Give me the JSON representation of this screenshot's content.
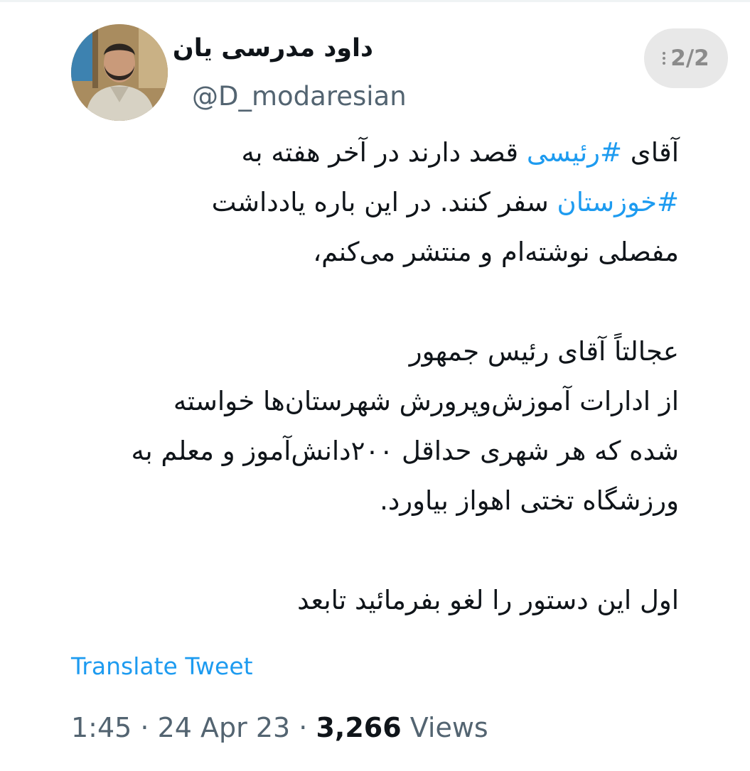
{
  "author": {
    "display_name": "داود مدرسی یان",
    "handle": "@D_modaresian"
  },
  "thread_counter": "2/2",
  "tweet": {
    "line1_prefix": "آقای ",
    "line1_hashtag": "#رئیسی",
    "line1_suffix": " قصد دارند در آخر هفته به",
    "line2_hashtag": "#خوزستان",
    "line2_suffix": " سفر کنند. در این باره یادداشت",
    "line3": "مفصلی نوشته‌ام و منتشر می‌کنم،",
    "line4": "عجالتاً آقای رئیس جمهور",
    "line5": "از ادارات آموزش‌وپرورش شهرستان‌ها خواسته",
    "line6": "شده که هر شهری حداقل ۲۰۰دانش‌آموز و معلم به",
    "line7": "ورزشگاه تختی اهواز بیاورد.",
    "line8": "اول این دستور را لغو بفرمائید تابعد"
  },
  "translate_label": "Translate Tweet",
  "meta": {
    "time": "1:45",
    "separator": " · ",
    "date": "24 Apr 23",
    "views_count": "3,266",
    "views_label": " Views"
  },
  "colors": {
    "link": "#1d9bf0",
    "secondary_text": "#536471",
    "primary_text": "#0f1419",
    "badge_bg": "#e8e8e8"
  },
  "icons": {
    "avatar": "profile-photo",
    "counter_grip": "drag-dots-icon"
  }
}
